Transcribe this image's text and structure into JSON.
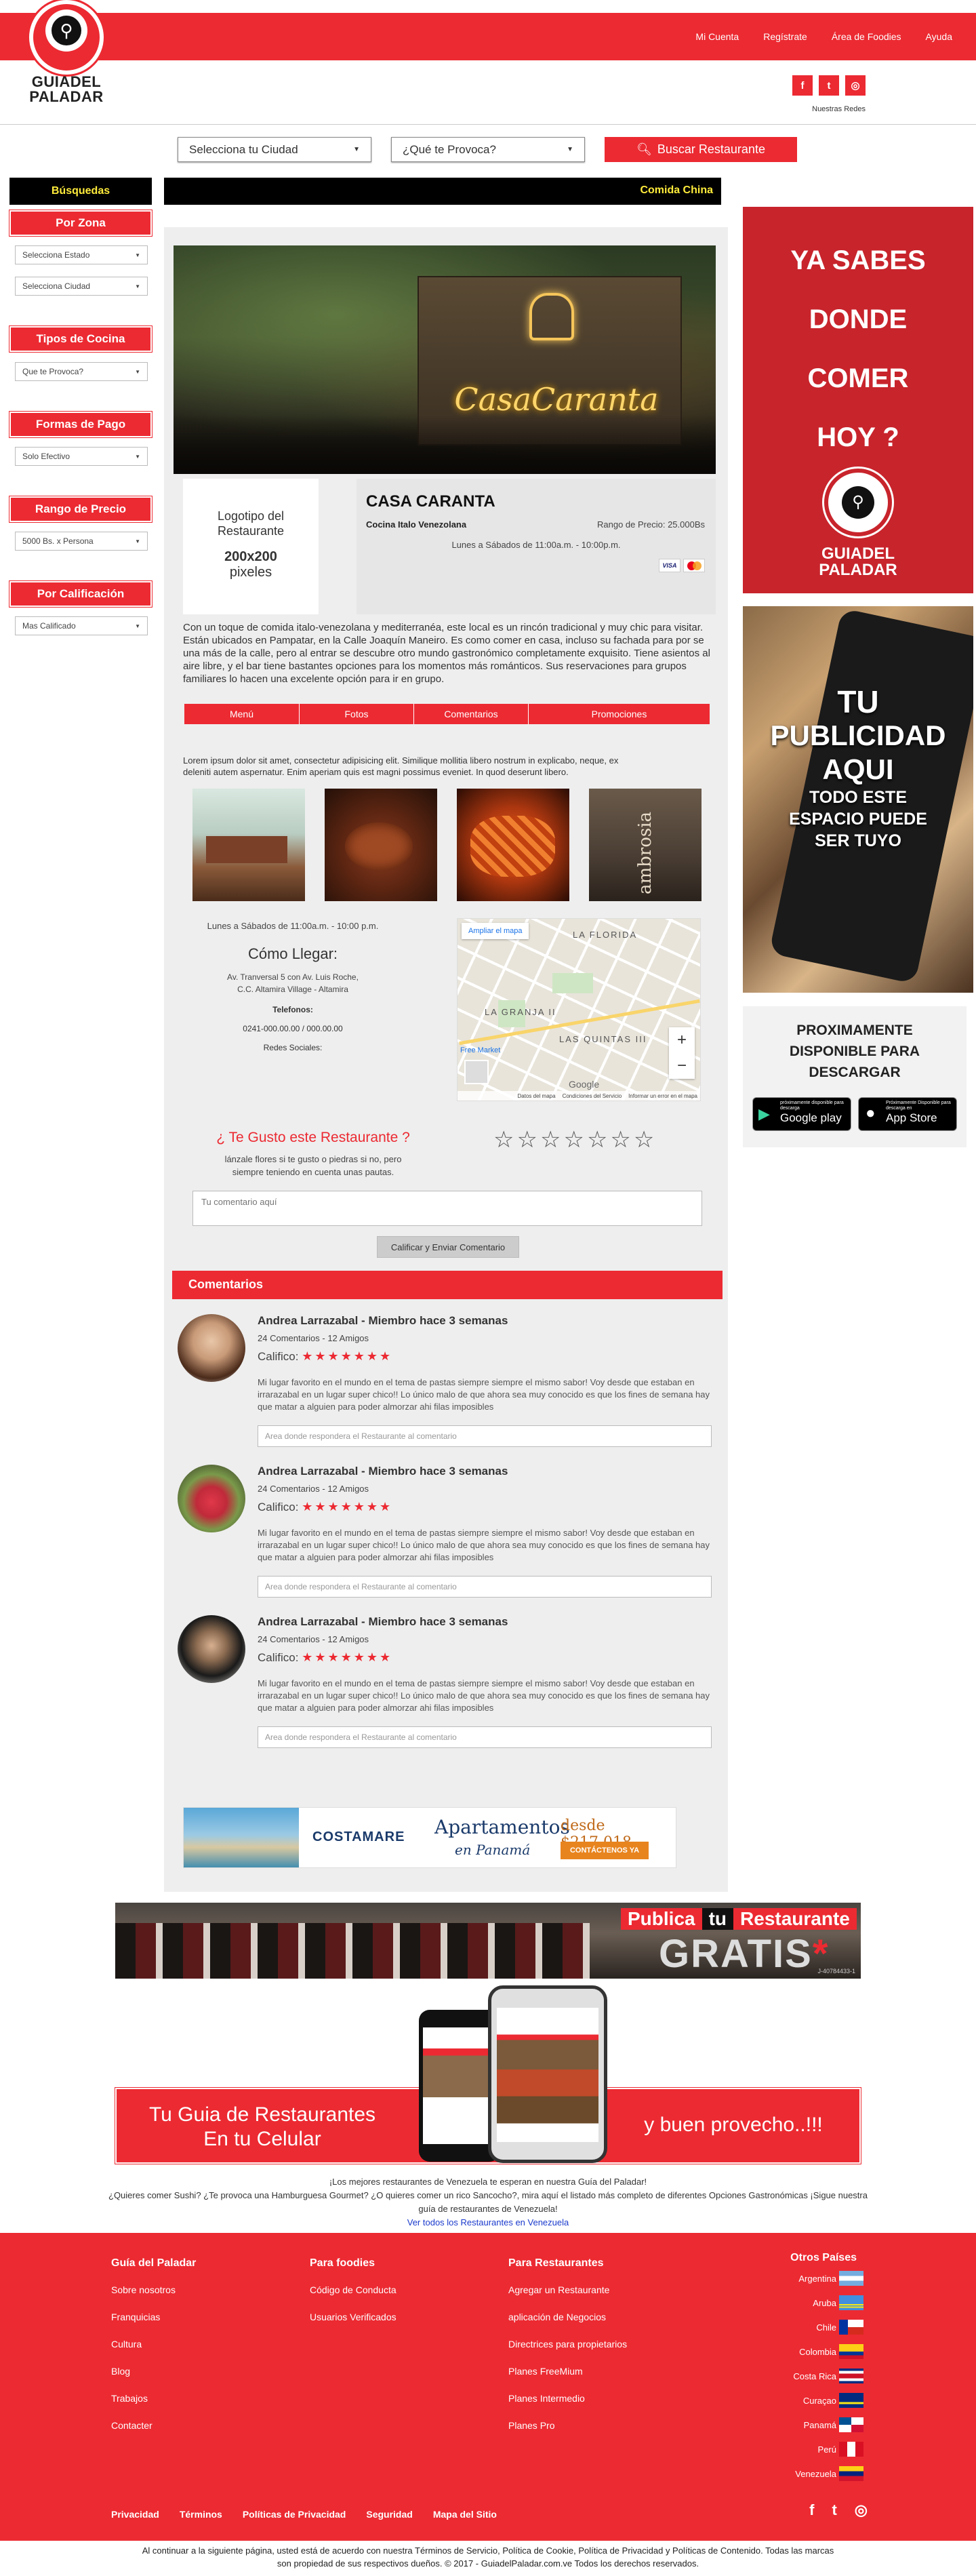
{
  "header": {
    "logo_text_top": "GUIADEL",
    "logo_text_bottom": "PALADAR",
    "nav": [
      "Mi Cuenta",
      "Regístrate",
      "Área de Foodies",
      "Ayuda"
    ],
    "social_label": "Nuestras Redes",
    "social_icons": [
      "facebook-icon",
      "twitter-icon",
      "instagram-icon"
    ]
  },
  "search": {
    "city": "Selecciona tu Ciudad",
    "craving": "¿Qué te Provoca?",
    "button": "Buscar Restaurante"
  },
  "sidebar": {
    "title": "Búsquedas",
    "zona": "Por Zona",
    "estado": "Selecciona Estado",
    "ciudad": "Selecciona Ciudad",
    "cocina_title": "Tipos de Cocina",
    "cocina": "Que te Provoca?",
    "pagos_title": "Formas de Pago",
    "pagos": "Solo Efectivo",
    "precio_title": "Rango de Precio",
    "precio": "5000 Bs. x Persona",
    "calif_title": "Por Calificación",
    "calif": "Mas Calificado"
  },
  "category_bar": "Comida China",
  "restaurant": {
    "logo_placeholder_1": "Logotipo del Restaurante",
    "logo_placeholder_size": "200x200",
    "logo_placeholder_unit": "pixeles",
    "name": "CASA CARANTA",
    "cuisine": "Cocina Italo Venezolana",
    "price_range": "Rango de Precio: 25.000Bs",
    "hours": "Lunes a Sábados de 11:00a.m. - 10:00p.m.",
    "payment_icons": [
      "visa-icon",
      "mastercard-icon"
    ],
    "sign_text": "CasaCaranta",
    "description": "Con un toque de comida italo-venezolana y mediterranéa, este local es un rincón tradicional y muy chic para visitar. Están ubicados en Pampatar, en la Calle Joaquín Maneiro. Es como comer en casa, incluso su fachada para por se una más de la calle, pero al entrar se descubre otro mundo gastronómico completamente exquisito. Tiene asientos al aire libre, y el bar tiene bastantes opciones para los momentos más románticos. Sus reservaciones para grupos familiares lo hacen una excelente opción para ir en grupo.",
    "tabs": [
      "Menú",
      "Fotos",
      "Comentarios",
      "Promociones"
    ],
    "lorem": "Lorem ipsum dolor sit amet, consectetur adipisicing elit. Similique mollitia libero nostrum in explicabo, neque, ex deleniti autem aspernatur. Enim aperiam quis est magni possimus eveniet. In quod deserunt libero.",
    "photo4_text": "ambrosia",
    "hours2": "Lunes a Sábados de 11:00a.m. - 10:00 p.m.",
    "como_llegar": "Cómo Llegar:",
    "address_1": "Av. Tranversal 5 con Av. Luis Roche,",
    "address_2": "C.C. Altamira Village - Altamira",
    "telefonos_label": "Telefonos:",
    "telefonos": "0241-000.00.00 / 000.00.00",
    "redes": "Redes Sociales:",
    "map": {
      "expand": "Ampliar el mapa",
      "labels": [
        "LA FLORIDA",
        "LA GRANJA II",
        "LAS QUINTAS III",
        "Free Market"
      ],
      "brand": "Google",
      "footer": [
        "Datos del mapa",
        "Condiciones del Servicio",
        "Informar un error en el mapa"
      ],
      "zoom_in": "+",
      "zoom_out": "−"
    }
  },
  "rating": {
    "question": "¿ Te Gusto este Restaurante ?",
    "hint": "lánzale flores si te gusto o piedras si no, pero siempre teniendo en cuenta unas pautas.",
    "stars": 7,
    "comment_placeholder": "Tu comentario aquí",
    "submit": "Calificar y Enviar Comentario"
  },
  "comments": {
    "title": "Comentarios",
    "items": [
      {
        "name": "Andrea Larrazabal - Miembro hace 3 semanas",
        "meta": "24 Comentarios - 12 Amigos",
        "calif_label": "Califico:",
        "stars": "★★★★★★★",
        "body": "Mi lugar favorito en el mundo en el tema de pastas siempre siempre el mismo sabor! Voy desde que estaban en irrarazabal en un lugar super chico!! Lo único malo de que ahora sea muy conocido es que los fines de semana hay que matar a alguien para poder almorzar ahi filas imposibles",
        "reply_placeholder": "Area donde respondera el Restaurante al comentario"
      },
      {
        "name": "Andrea Larrazabal - Miembro hace 3 semanas",
        "meta": "24 Comentarios - 12 Amigos",
        "calif_label": "Califico:",
        "stars": "★★★★★★★",
        "body": "Mi lugar favorito en el mundo en el tema de pastas siempre siempre el mismo sabor! Voy desde que estaban en irrarazabal en un lugar super chico!! Lo único malo de que ahora sea muy conocido es que los fines de semana hay que matar a alguien para poder almorzar ahi filas imposibles",
        "reply_placeholder": "Area donde respondera el Restaurante al comentario"
      },
      {
        "name": "Andrea Larrazabal - Miembro hace 3 semanas",
        "meta": "24 Comentarios - 12 Amigos",
        "calif_label": "Califico:",
        "stars": "★★★★★★★",
        "body": "Mi lugar favorito en el mundo en el tema de pastas siempre siempre el mismo sabor! Voy desde que estaban en irrarazabal en un lugar super chico!! Lo único malo de que ahora sea muy conocido es que los fines de semana hay que matar a alguien para poder almorzar ahi filas imposibles",
        "reply_placeholder": "Area donde respondera el Restaurante al comentario"
      }
    ]
  },
  "banner_costamare": {
    "brand": "COSTAMARE",
    "title": "Apartamentos",
    "subtitle": "en Panamá",
    "price": "desde $217,018",
    "cta": "CONTÁCTENOS YA"
  },
  "banner_publica": {
    "word1": "Publica",
    "word2": "tu",
    "word3": "Restaurante",
    "gratis": "GRATIS",
    "asterisk": "*",
    "code": "J-40784433-1"
  },
  "banner_app": {
    "left_1": "Tu Guia de Restaurantes",
    "left_2": "En tu Celular",
    "right": "y  buen provecho..!!!"
  },
  "right_ads": {
    "ad1_lines": [
      "YA SABES",
      "DONDE",
      "COMER",
      "HOY ?"
    ],
    "ad1_logo_top": "GUIADEL",
    "ad1_logo_bottom": "PALADAR",
    "ad2_lines": [
      "TU",
      "PUBLICIDAD",
      "AQUI",
      "TODO ESTE",
      "ESPACIO PUEDE",
      "SER TUYO"
    ],
    "ad3_title": "PROXIMAMENTE DISPONIBLE PARA DESCARGAR",
    "google_small": "próximamente disponible para descarga",
    "google_big": "Google play",
    "apple_small": "Próximamente Disponible para descarga en",
    "apple_big": "App Store"
  },
  "intro": {
    "line1": "¡Los mejores restaurantes de Venezuela te esperan en nuestra Guía del Paladar!",
    "line2": "¿Quieres comer Sushi? ¿Te provoca una Hamburguesa Gourmet? ¿O quieres comer un rico Sancocho?, mira aquí el listado más completo de diferentes Opciones Gastronómicas ¡Sigue nuestra guía de restaurantes de Venezuela!",
    "link": "Ver todos los Restaurantes en Venezuela"
  },
  "footer": {
    "col1_title": "Guía del Paladar",
    "col1": [
      "Sobre nosotros",
      "Franquicias",
      "Cultura",
      "Blog",
      "Trabajos",
      "Contacter"
    ],
    "col2_title": "Para foodies",
    "col2": [
      "Código de Conducta",
      "Usuarios Verificados"
    ],
    "col3_title": "Para Restaurantes",
    "col3": [
      "Agregar un Restaurante",
      "aplicación de Negocios",
      "Directrices para propietarios",
      "Planes FreeMium",
      "Planes Intermedio",
      "Planes Pro"
    ],
    "col4_title": "Otros Países",
    "countries": [
      "Argentina",
      "Aruba",
      "Chile",
      "Colombia",
      "Costa Rica",
      "Curaçao",
      "Panamá",
      "Perú",
      "Venezuela"
    ],
    "bottom_links": [
      "Privacidad",
      "Términos",
      "Políticas de Privacidad",
      "Seguridad",
      "Mapa del Sitio"
    ],
    "legal_1": "Al continuar a la siguiente página, usted está de acuerdo con nuestra Términos de Servicio, Política de Cookie, Política de Privacidad y Políticas de Contenido. Todas las marcas",
    "legal_2": "son propiedad de sus respectivos dueños. © 2017 - GuiadelPaladar.com.ve Todos los derechos reservados."
  },
  "colors": {
    "brand_red": "#ec2a32",
    "category_yellow": "#ffeb3b",
    "footer_red": "#ec2a32"
  }
}
